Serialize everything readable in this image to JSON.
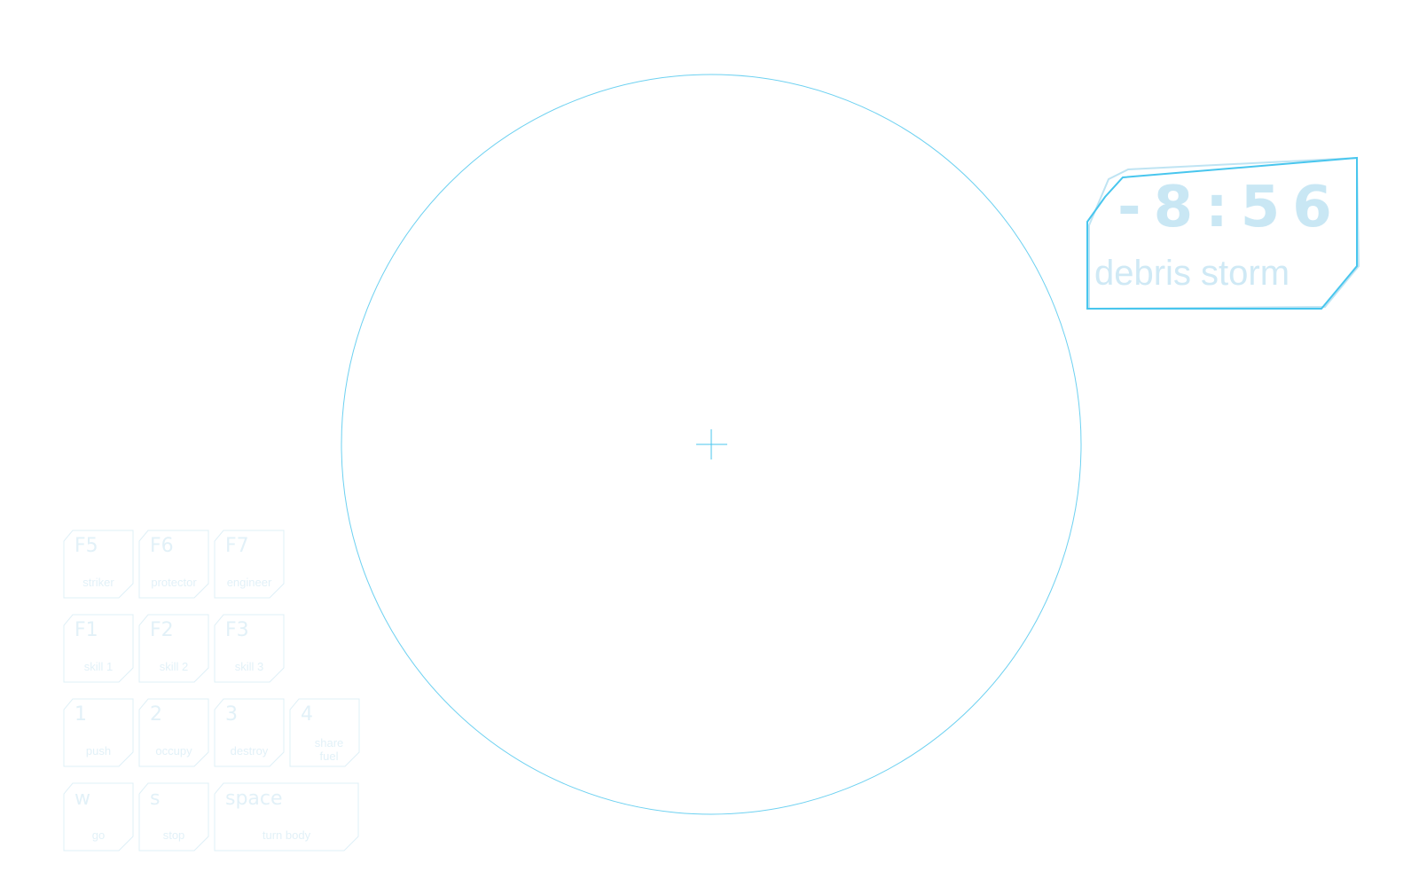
{
  "colors": {
    "accent": "#48c6ee",
    "accent_faint": "#bfe4f3",
    "key_outline": "#dff0f7",
    "text_faint": "#e2f1f8"
  },
  "hud": {
    "countdown": "-8:56",
    "event": "debris storm"
  },
  "keys": [
    {
      "id": "f5",
      "key": "F5",
      "action": "striker"
    },
    {
      "id": "f6",
      "key": "F6",
      "action": "protector"
    },
    {
      "id": "f7",
      "key": "F7",
      "action": "engineer"
    },
    {
      "id": "f1",
      "key": "F1",
      "action": "skill 1"
    },
    {
      "id": "f2",
      "key": "F2",
      "action": "skill 2"
    },
    {
      "id": "f3",
      "key": "F3",
      "action": "skill 3"
    },
    {
      "id": "1",
      "key": "1",
      "action": "push"
    },
    {
      "id": "2",
      "key": "2",
      "action": "occupy"
    },
    {
      "id": "3",
      "key": "3",
      "action": "destroy"
    },
    {
      "id": "4",
      "key": "4",
      "action": "share fuel"
    },
    {
      "id": "w",
      "key": "w",
      "action": "go"
    },
    {
      "id": "s",
      "key": "s",
      "action": "stop"
    },
    {
      "id": "space",
      "key": "space",
      "action": "turn body"
    }
  ],
  "icons": {
    "crosshair": "crosshair-icon"
  }
}
